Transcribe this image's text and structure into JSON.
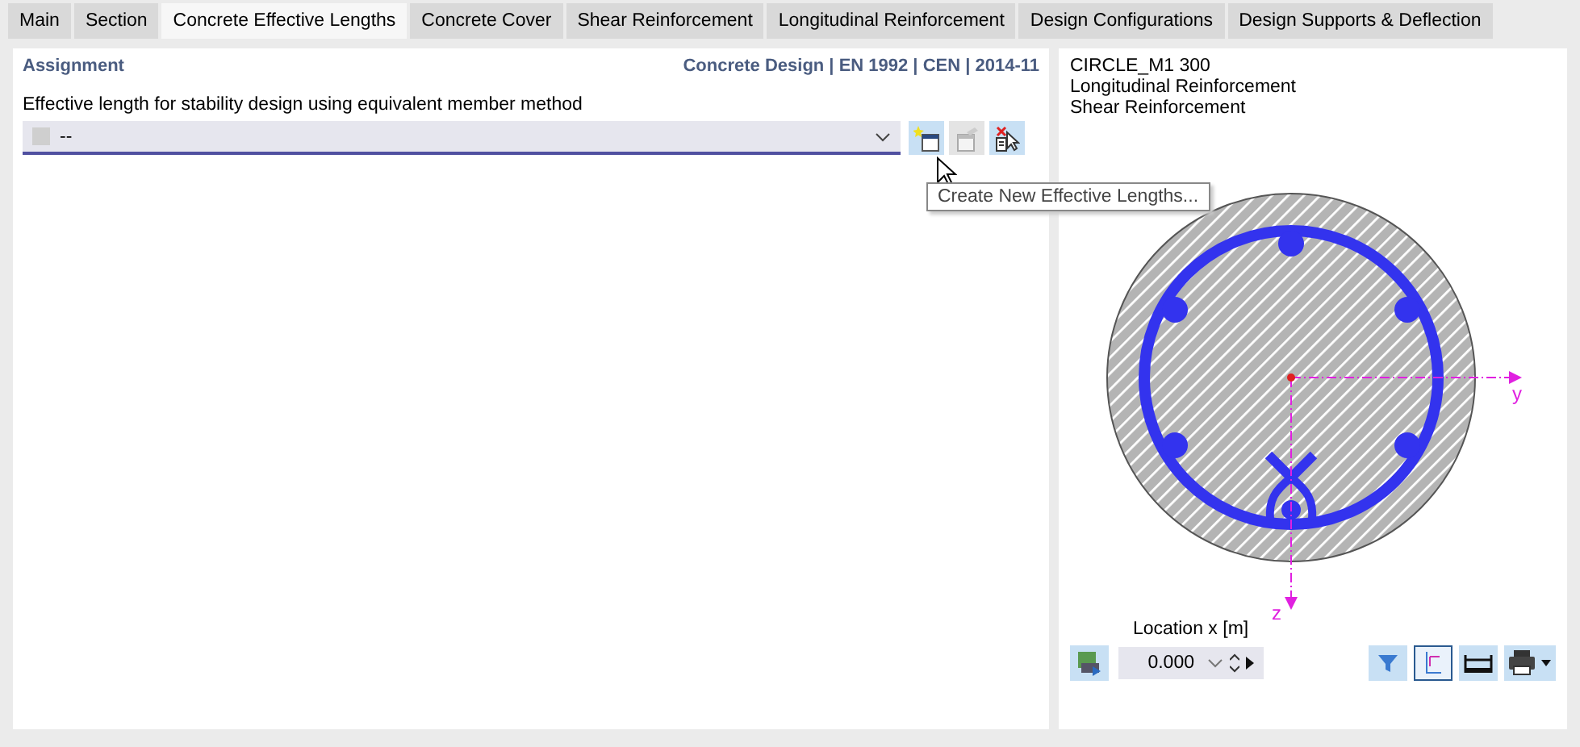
{
  "tabs": [
    {
      "label": "Main",
      "selected": false
    },
    {
      "label": "Section",
      "selected": false
    },
    {
      "label": "Concrete Effective Lengths",
      "selected": true
    },
    {
      "label": "Concrete Cover",
      "selected": false
    },
    {
      "label": "Shear Reinforcement",
      "selected": false
    },
    {
      "label": "Longitudinal Reinforcement",
      "selected": false
    },
    {
      "label": "Design Configurations",
      "selected": false
    },
    {
      "label": "Design Supports & Deflection",
      "selected": false
    }
  ],
  "assignment": {
    "title": "Assignment",
    "standard": "Concrete Design | EN 1992 | CEN | 2014-11",
    "field_label": "Effective length for stability design using equivalent member method",
    "value": "--",
    "buttons": [
      {
        "kind": "new",
        "disabled": false
      },
      {
        "kind": "edit",
        "disabled": true
      },
      {
        "kind": "pick",
        "disabled": false
      }
    ],
    "tooltip": "Create New Effective Lengths..."
  },
  "preview": {
    "lines": [
      "CIRCLE_M1 300",
      "Longitudinal Reinforcement",
      "Shear Reinforcement"
    ],
    "axes": [
      "y",
      "z"
    ],
    "location_label": "Location x [m]",
    "location_value": "0.000",
    "tools": [
      {
        "kind": "filter",
        "selected": false
      },
      {
        "kind": "axes",
        "selected": true
      },
      {
        "kind": "dimension",
        "selected": false
      },
      {
        "kind": "print",
        "selected": false
      }
    ]
  }
}
